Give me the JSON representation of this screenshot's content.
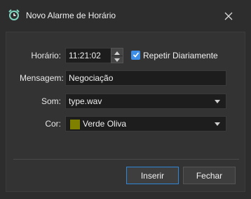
{
  "dialog": {
    "title": "Novo Alarme de Horário",
    "title_icon": "alarm-clock-icon",
    "close_icon": "close-icon"
  },
  "form": {
    "time": {
      "label": "Horário:",
      "value": "11:21:02"
    },
    "repeat": {
      "label": "Repetir Diariamente",
      "checked": true
    },
    "message": {
      "label": "Mensagem:",
      "value": "Negociação"
    },
    "sound": {
      "label": "Som:",
      "value": "type.wav"
    },
    "color": {
      "label": "Cor:",
      "value": "Verde Oliva",
      "swatch_color": "#808000"
    }
  },
  "buttons": {
    "insert": "Inserir",
    "close": "Fechar"
  },
  "colors": {
    "accent": "#3d8ee8",
    "background": "#2d2d2d"
  }
}
